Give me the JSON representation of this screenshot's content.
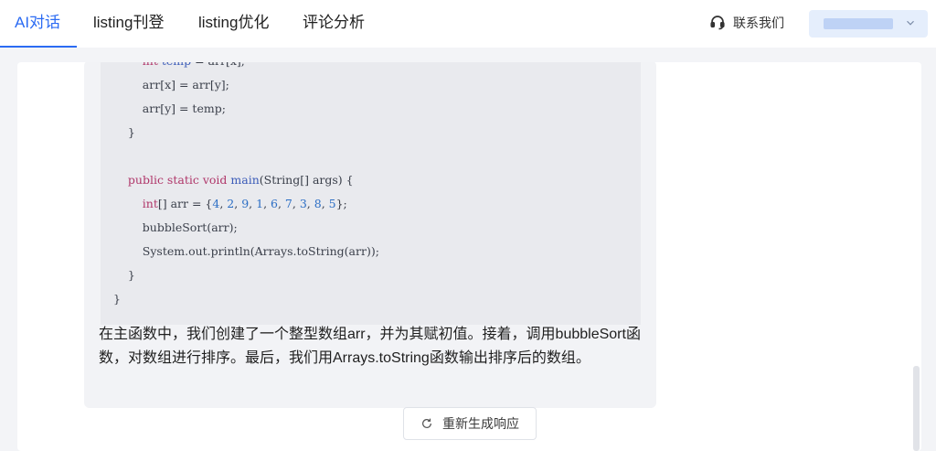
{
  "header": {
    "tabs": [
      {
        "label": "AI对话",
        "active": true
      },
      {
        "label": "listing刊登",
        "active": false
      },
      {
        "label": "listing优化",
        "active": false
      },
      {
        "label": "评论分析",
        "active": false
      }
    ],
    "contact_label": "联系我们",
    "accent_color": "#2b6bf3"
  },
  "chat": {
    "code_lines": [
      [
        {
          "t": "        "
        },
        {
          "t": "int",
          "c": "kw"
        },
        {
          "t": " temp",
          "c": "fn"
        },
        {
          "t": " = arr[x];"
        }
      ],
      [
        {
          "t": "        arr[x] = arr[y];"
        }
      ],
      [
        {
          "t": "        arr[y] = temp;"
        }
      ],
      [
        {
          "t": "    }"
        }
      ],
      [
        {
          "t": ""
        }
      ],
      [
        {
          "t": "    "
        },
        {
          "t": "public static void",
          "c": "kw"
        },
        {
          "t": " "
        },
        {
          "t": "main",
          "c": "fn"
        },
        {
          "t": "(String[] args) {"
        }
      ],
      [
        {
          "t": "        "
        },
        {
          "t": "int",
          "c": "kw"
        },
        {
          "t": "[] arr = {"
        },
        {
          "t": "4",
          "c": "num"
        },
        {
          "t": ", "
        },
        {
          "t": "2",
          "c": "num"
        },
        {
          "t": ", "
        },
        {
          "t": "9",
          "c": "num"
        },
        {
          "t": ", "
        },
        {
          "t": "1",
          "c": "num"
        },
        {
          "t": ", "
        },
        {
          "t": "6",
          "c": "num"
        },
        {
          "t": ", "
        },
        {
          "t": "7",
          "c": "num"
        },
        {
          "t": ", "
        },
        {
          "t": "3",
          "c": "num"
        },
        {
          "t": ", "
        },
        {
          "t": "8",
          "c": "num"
        },
        {
          "t": ", "
        },
        {
          "t": "5",
          "c": "num"
        },
        {
          "t": "};"
        }
      ],
      [
        {
          "t": "        bubbleSort(arr);"
        }
      ],
      [
        {
          "t": "        System.out.println(Arrays.toString(arr));"
        }
      ],
      [
        {
          "t": "    }"
        }
      ],
      [
        {
          "t": "}"
        }
      ]
    ],
    "answer_text": "在主函数中，我们创建了一个整型数组arr，并为其赋初值。接着，调用bubbleSort函数，对数组进行排序。最后，我们用Arrays.toString函数输出排序后的数组。",
    "regenerate_label": "重新生成响应"
  }
}
